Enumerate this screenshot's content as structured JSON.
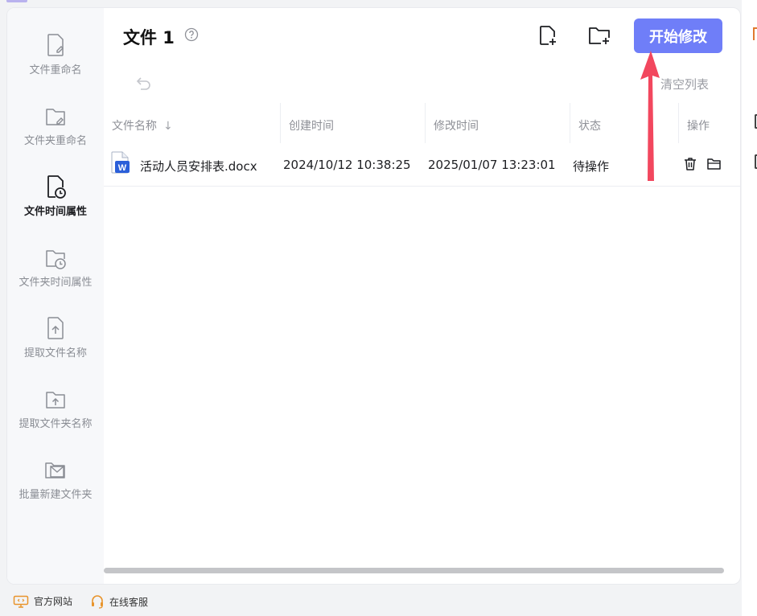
{
  "header": {
    "title": "文件 1",
    "start_button": "开始修改",
    "clear_list": "清空列表"
  },
  "sidebar": {
    "items": [
      {
        "label": "文件重命名",
        "icon": "file-edit-icon",
        "active": false
      },
      {
        "label": "文件夹重命名",
        "icon": "folder-edit-icon",
        "active": false
      },
      {
        "label": "文件时间属性",
        "icon": "file-clock-icon",
        "active": true
      },
      {
        "label": "文件夹时间属性",
        "icon": "folder-clock-icon",
        "active": false
      },
      {
        "label": "提取文件名称",
        "icon": "file-upload-icon",
        "active": false
      },
      {
        "label": "提取文件夹名称",
        "icon": "folder-upload-icon",
        "active": false
      },
      {
        "label": "批量新建文件夹",
        "icon": "folder-mail-icon",
        "active": false
      }
    ]
  },
  "table": {
    "columns": [
      "文件名称",
      "创建时间",
      "修改时间",
      "状态",
      "操作"
    ],
    "rows": [
      {
        "name": "活动人员安排表.docx",
        "created": "2024/10/12 10:38:25",
        "modified": "2025/01/07 13:23:01",
        "status": "待操作"
      }
    ]
  },
  "footer": {
    "website": "官方网站",
    "support": "在线客服"
  },
  "colors": {
    "accent": "#6f7ef8",
    "arrow": "#f2475e",
    "word_blue": "#2b5fd9"
  }
}
